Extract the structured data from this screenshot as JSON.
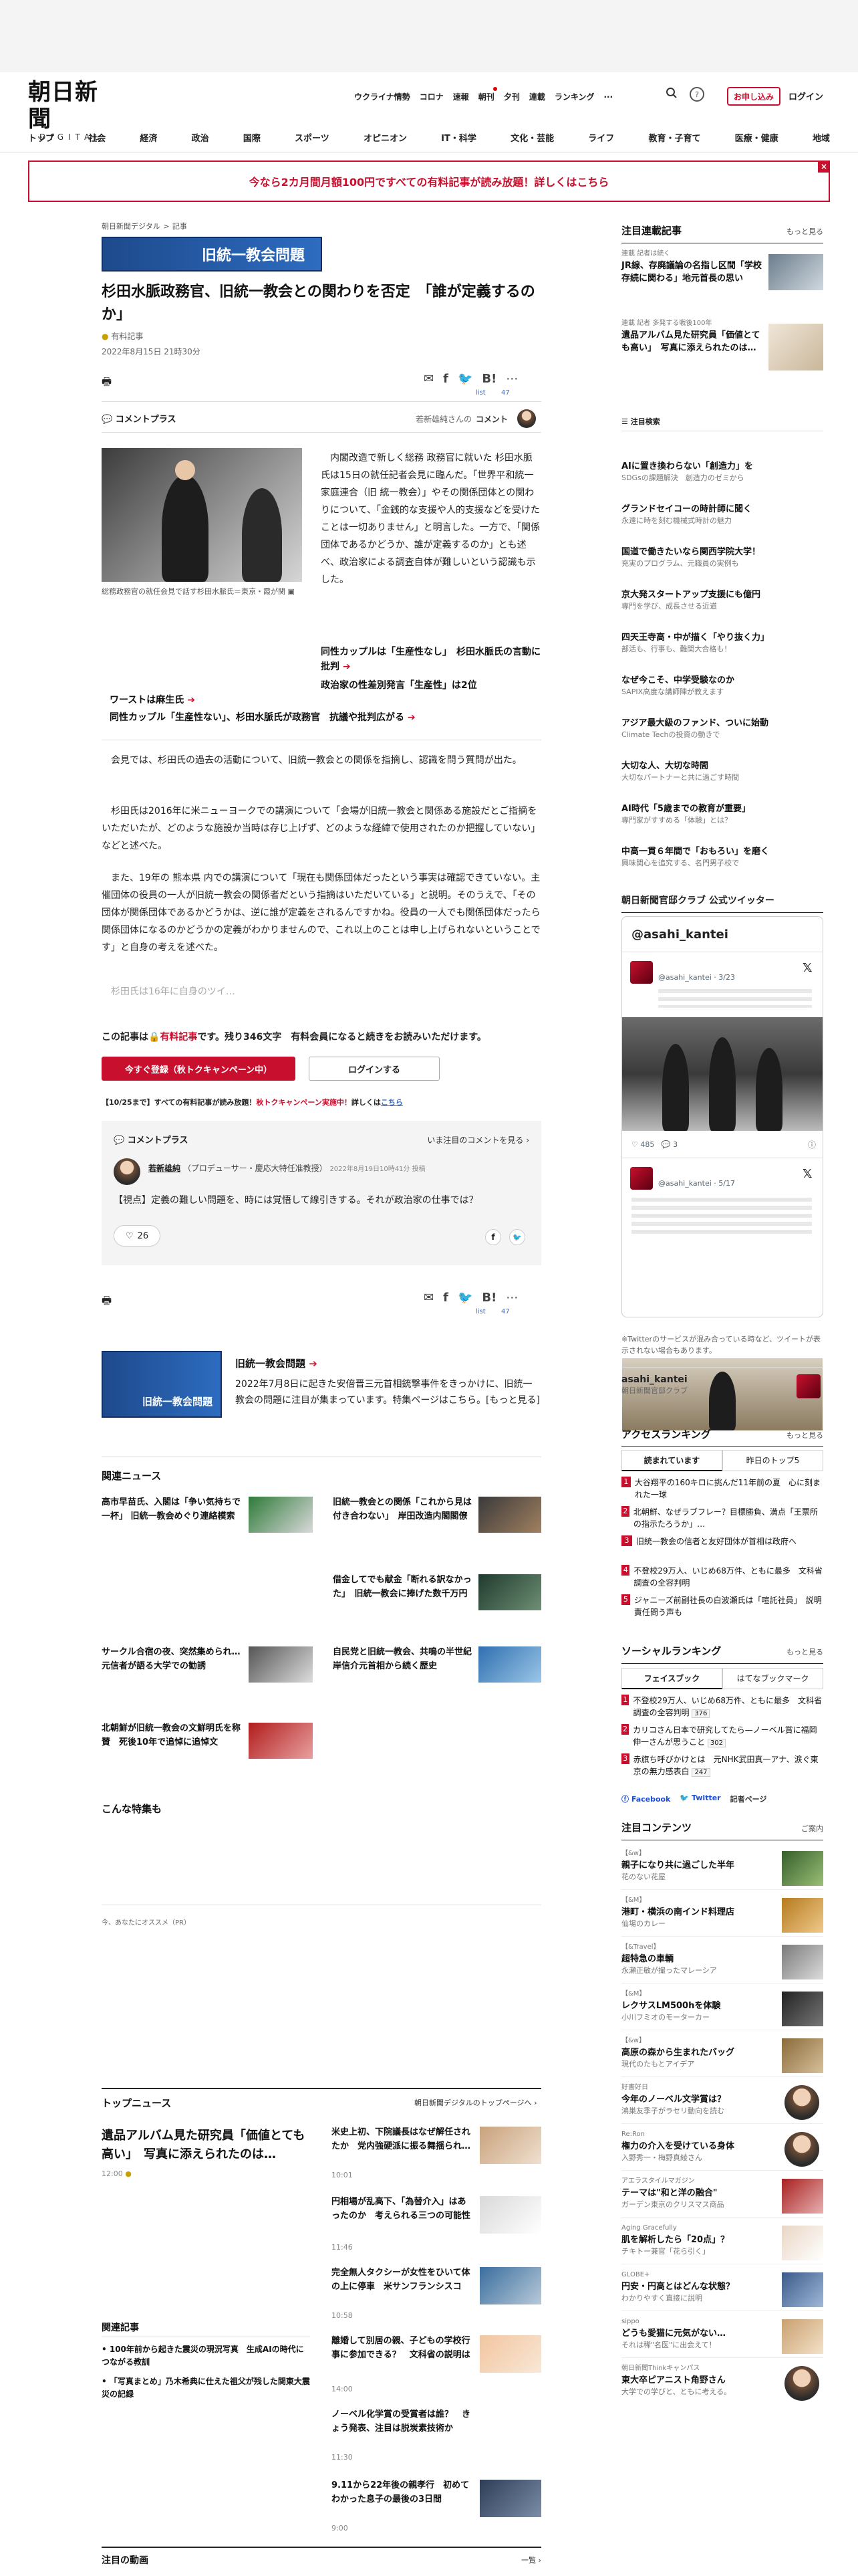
{
  "header": {
    "logo_main": "朝日新聞",
    "logo_sub": "DIGITAL",
    "util_nav": [
      "ウクライナ情勢",
      "コロナ",
      "速報",
      "朝刊",
      "夕刊",
      "連載",
      "ランキング"
    ],
    "more_icon": "···",
    "subscribe_label": "お申し込み",
    "login_label": "ログイン",
    "main_nav": [
      "トップ",
      "社会",
      "経済",
      "政治",
      "国際",
      "スポーツ",
      "オピニオン",
      "IT・科学",
      "文化・芸能",
      "ライフ",
      "教育・子育て",
      "医療・健康",
      "地域"
    ]
  },
  "banner": {
    "text": "今なら2カ月間月額100円ですべての有料記事が読み放題！詳しくはこちら",
    "close": "×"
  },
  "article": {
    "breadcrumb_site": "朝日新聞デジタル",
    "breadcrumb_sep": ">",
    "breadcrumb_cat": "記事",
    "series_label": "旧統一教会問題",
    "headline": "杉田水脈政務官、旧統一教会との関わりを否定　「誰が定義するのか」",
    "badge": "有料記事",
    "date": "2022年8月15日 21時30分",
    "list_label": "list",
    "list_count": "47",
    "comment_plus": "コメントプラス",
    "commenter_note": "若新雄純さんの",
    "commenter_link": "コメント",
    "photo_caption": "総務政務官の就任会見で話す杉田水脈氏＝東京・霞が関",
    "lead": "内閣改造で新しく総務 政務官に就いた 杉田水脈 氏は15日の就任記者会見に臨んだ。「世界平和統一家庭連合（旧 統一教会）」やその関係団体との関わりについて、「金銭的な支援や人的支援などを受けたことは一切ありません」と明言した。一方で、「関係団体であるかどうか、誰が定義するのか」とも述べ、政治家による調査自体が難しいという認識も示した。",
    "rel_links": [
      "同性カップルは「生産性なし」　杉田水脈氏の言動に批判",
      "政治家の性差別発言「生産性」は2位",
      "ワーストは麻生氏",
      "同性カップル「生産性ない」、杉田水脈氏が政務官　抗議や批判広がる"
    ],
    "paragraphs": [
      "会見では、杉田氏の過去の活動について、旧統一教会との関係を指摘し、認識を問う質問が出た。",
      "杉田氏は2016年に米ニューヨークでの講演について「会場が旧統一教会と関係ある施設だとご指摘をいただいたが、どのような施設か当時は存じ上げず、どのような経緯で使用されたのか把握していない」などと述べた。",
      "また、19年の 熊本県 内での講演について「現在も関係団体だったという事実は確認できていない。主催団体の役員の一人が旧統一教会の関係者だという指摘はいただいている」と説明。そのうえで、「その団体が関係団体であるかどうかは、逆に誰が定義をされるんですかね。役員の一人でも関係団体だったら関係団体になるのかどうかの定義がわかりませんので、これ以上のことは申し上げられないということです」と自身の考えを述べた。"
    ],
    "faded_line": "杉田氏は16年に自身のツイ…",
    "paywall_prefix": "この記事は",
    "paywall_tag": "有料記事",
    "paywall_suffix": "です。残り346文字　有料会員になると続きをお読みいただけます。",
    "register_btn": "今すぐ登録（秋トクキャンペーン中）",
    "login_btn": "ログインする",
    "campaign_note_a": "【10/25まで】すべての有料記事が読み放題！",
    "campaign_note_b": "秋トクキャンペーン実施中！",
    "campaign_note_c": "詳しくは",
    "campaign_note_link": "こちら"
  },
  "comment_card": {
    "title": "コメントプラス",
    "read_all": "いま注目のコメントを見る",
    "name": "若新雄純",
    "role": "（プロデューサー・慶応大特任准教授）",
    "date": "2022年8月19日10時41分 投稿",
    "body": "【視点】定義の難しい問題を、時には覚悟して線引きする。それが政治家の仕事では？",
    "likes": "26"
  },
  "series_promo": {
    "title": "旧統一教会問題",
    "desc": "2022年7月8日に起きた安倍晋三元首相銃撃事件をきっかけに、旧統一教会の問題に注目が集まっています。特集ページはこちら。[もっと見る]"
  },
  "related": {
    "title": "関連ニュース",
    "items": [
      "高市早苗氏、入閣は「争い気持ちで一杯」 旧統一教会めぐり連絡模索",
      "旧統一教会との関係「これから見は付き合わない」　岸田改造内閣閣僚",
      "借金してでも献金「断れる訳なかった」　旧統一教会に捧げた数千万円",
      "サークル合宿の夜、突然集められ…　元信者が語る大学での勧誘",
      "自民党と旧統一教会、共鳴の半世紀　岸信介元首相から続く歴史",
      "北朝鮮が旧統一教会の文鮮明氏を称賛　死後10年で追悼に追悼文"
    ]
  },
  "feature": {
    "title": "こんな特集も",
    "pr_label": "今、あなたにオススメ（PR）"
  },
  "top_news": {
    "title": "トップニュース",
    "link": "朝日新聞デジタルのトップページへ",
    "lead_title": "遺品アルバム見た研究員「価値とても高い」　写真に添えられたのは…",
    "lead_time": "12:00",
    "items": [
      {
        "title": "米史上初、下院議長はなぜ解任されたか　党内強硬派に振る舞揺られ…",
        "time": "10:01"
      },
      {
        "title": "円相場が乱高下、「為替介入」はあったのか　考えられる三つの可能性",
        "time": "11:46"
      },
      {
        "title": "完全無人タクシーが女性をひいて体の上に停車　米サンフランシスコ",
        "time": "10:58"
      },
      {
        "title": "離婚して別居の親、子どもの学校行事に参加できる？　文科省の説明は",
        "time": "14:00"
      },
      {
        "title": "ノーベル化学賞の受賞者は誰？　きょう発表、注目は脱炭素技術か",
        "time": "11:30"
      },
      {
        "title": "9.11から22年後の親孝行　初めてわかった息子の最後の3日間",
        "time": "9:00"
      }
    ],
    "related_title": "関連記事",
    "related_items": [
      "100年前から起きた震災の現況写真　生成AIの時代につながる教訓",
      "「写真まとめ」乃木希典に仕えた祖父が残した関東大震災の記録"
    ]
  },
  "bottom": {
    "title": "注目の動画",
    "link": "一覧"
  },
  "sidebar": {
    "attention_title": "注目連載記事",
    "attention_more": "もっと見る",
    "attention": [
      {
        "kicker": "連載 記者は続く",
        "title": "JR線、存廃議論の名指し区間「学校存続に関わる」地元首長の思い"
      },
      {
        "kicker": "連載 記者 多発する戦後100年",
        "title": "遺品アルバム見た研究員「価値とても高い」　写真に添えられたのは…"
      }
    ],
    "featured_label": "注目検索",
    "featured": [
      {
        "title": "AIに置き換わらない「創造力」を",
        "sub": "SDGsの課題解決　創造力のゼミから"
      },
      {
        "title": "グランドセイコーの時計師に聞く",
        "sub": "永遠に時を刻む機械式時計の魅力"
      },
      {
        "title": "国道で働きたいなら関西学院大学！",
        "sub": "充実のプログラム、元職員の実例も"
      },
      {
        "title": "京大発スタートアップ支援にも億円",
        "sub": "専門を学び、成長させる近道"
      },
      {
        "title": "四天王寺高・中が描く「やり抜く力」",
        "sub": "部活も、行事も、難関大合格も！"
      },
      {
        "title": "なぜ今こそ、中学受験なのか",
        "sub": "SAPIX高度な講師陣が教えます"
      },
      {
        "title": "アジア最大級のファンド、ついに始動",
        "sub": "Climate Techの投資の動きで"
      },
      {
        "title": "大切な人、大切な時間",
        "sub": "大切なパートナーと共に過ごす時間"
      },
      {
        "title": "AI時代「5歳までの教育が重要」",
        "sub": "専門家がすすめる「体験」とは？"
      },
      {
        "title": "中高一貫６年間で「おもろい」を磨く",
        "sub": "興味関心を追究する、名門男子校で"
      }
    ],
    "twitter_title": "朝日新聞官邸クラブ 公式ツイッター",
    "twitter_handle_head": "@asahi_kantei",
    "tweets": [
      {
        "handle": "@asahi_kantei · 3/23",
        "likes": "485",
        "replies": "3"
      },
      {
        "handle": "@asahi_kantei · 5/17",
        "likes": "",
        "replies": ""
      }
    ],
    "twitter_note": "※Twitterのサービスが混み合っている時など、ツイートが表示されない場合もあります。",
    "twitter_account": "asahi_kantei",
    "twitter_account_sub": "朝日新聞官邸クラブ",
    "ranking_title": "アクセスランキング",
    "ranking_more": "もっと見る",
    "ranking_tabs": [
      "読まれています",
      "昨日のトップ5"
    ],
    "ranking": [
      "大谷翔平の160キロに挑んだ11年前の夏　心に刻まれた一球",
      "北朝鮮、なぜラブフレー？目標勝負、満点「王票所の指示たろうか」…",
      "旧統一教会の信者と友好団体が首相は政府へ",
      "不登校29万人、いじめ68万件、ともに最多　文科省調査の全容判明",
      "ジャニーズ前副社長の白波瀬氏は「喧託社員」　説明責任問う声も"
    ],
    "social_title": "ソーシャルランキング",
    "social_more": "もっと見る",
    "social_tabs": [
      "フェイスブック",
      "はてなブックマーク"
    ],
    "social": [
      {
        "title": "不登校29万人、いじめ68万件、ともに最多　文科省調査の全容判明",
        "count": "376"
      },
      {
        "title": "カリコさん日本で研究してたら—ノーベル賞に福岡伸一さんが思うこと",
        "count": "302"
      },
      {
        "title": "赤旗ち呼びかけとは　元NHK武田真一アナ、涙ぐ東京の無力感表白",
        "count": "247"
      }
    ],
    "social_footer": [
      "Facebook",
      "Twitter",
      "記者ページ"
    ],
    "contents_title": "注目コンテンツ",
    "contents_more": "ご案内",
    "contents": [
      {
        "kicker": "【&w】",
        "title": "親子になり共に過ごした半年",
        "sub": "花のない花屋"
      },
      {
        "kicker": "【&M】",
        "title": "港町・横浜の南インド料理店",
        "sub": "仙場のカレー"
      },
      {
        "kicker": "【&Travel】",
        "title": "超特急の車輌",
        "sub": "永瀬正敏が撮ったマレーシア"
      },
      {
        "kicker": "【&M】",
        "title": "レクサスLM500hを体験",
        "sub": "小川フミオのモーターカー"
      },
      {
        "kicker": "【&w】",
        "title": "高原の森から生まれたバッグ",
        "sub": "現代のたもとアイデア"
      },
      {
        "kicker": "好書好日",
        "title": "今年のノーベル文学賞は？",
        "sub": "鴻巣友季子がラセリ動向を読む"
      },
      {
        "kicker": "Re:Ron",
        "title": "権力の介入を受けている身体",
        "sub": "入野秀一・梅野真綾さん"
      },
      {
        "kicker": "アエラスタイルマガジン",
        "title": "テーマは\"和と洋の融合\"",
        "sub": "ガーデン東京のクリスマス商品"
      },
      {
        "kicker": "Aging Gracefully",
        "title": "肌を解析したら「20点」？",
        "sub": "チキトー兼官「花ら引く」"
      },
      {
        "kicker": "GLOBE+",
        "title": "円安・円高とはどんな状態？",
        "sub": "わかりやすく直接に説明"
      },
      {
        "kicker": "sippo",
        "title": "どうも愛猫に元気がない…",
        "sub": "それは稀\"名医\"に出会えて！"
      },
      {
        "kicker": "朝日新聞Thinkキャンパス",
        "title": "東大卒ピアニスト角野さん",
        "sub": "大学での学びと、ともに考える。"
      }
    ]
  }
}
